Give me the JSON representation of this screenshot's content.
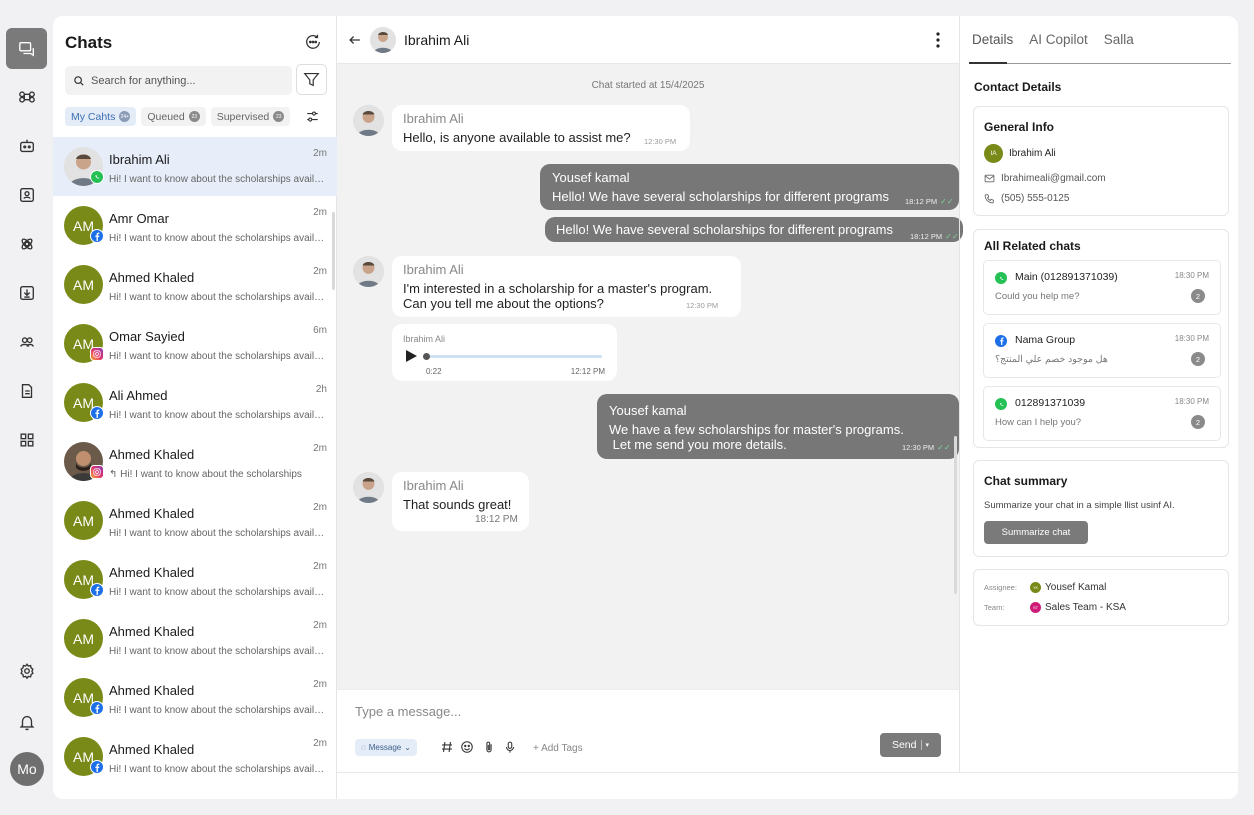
{
  "colors": {
    "accent_blue": "#3d6fb4",
    "avatar_olive": "#7a8a18",
    "whatsapp": "#25c155",
    "facebook": "#1c6fe8",
    "neutral_button": "#7a7a7a"
  },
  "rail": {
    "icons": [
      "chat-bubbles-icon",
      "command-icon",
      "bot-icon",
      "contacts-icon",
      "integrations-icon",
      "download-icon",
      "team-icon",
      "document-icon",
      "apps-grid-icon",
      "settings-icon",
      "bell-icon"
    ],
    "user_initials": "Mo"
  },
  "list": {
    "title": "Chats",
    "search_placeholder": "Search for anything...",
    "tabs": [
      {
        "label": "My Cahts",
        "count": "24+"
      },
      {
        "label": "Queued",
        "count": "23"
      },
      {
        "label": "Supervised",
        "count": "23"
      }
    ],
    "items": [
      {
        "name": "Ibrahim Ali",
        "initials": "",
        "time": "2m",
        "preview": "Hi! I want to know about the scholarships available",
        "channel": "whatsapp"
      },
      {
        "name": "Amr Omar",
        "initials": "AM",
        "time": "2m",
        "preview": "Hi! I want to know about the scholarships available",
        "channel": "facebook"
      },
      {
        "name": "Ahmed Khaled",
        "initials": "AM",
        "time": "2m",
        "preview": "Hi! I want to know about the scholarships available",
        "channel": ""
      },
      {
        "name": "Omar Sayied",
        "initials": "AM",
        "time": "6m",
        "preview": "Hi! I want to know about the scholarships available",
        "channel": "instagram"
      },
      {
        "name": "Ali Ahmed",
        "initials": "AM",
        "time": "2h",
        "preview": "Hi! I want to know about the scholarships available",
        "channel": "facebook"
      },
      {
        "name": "Ahmed Khaled",
        "initials": "",
        "time": "2m",
        "preview": "↰ Hi! I want to know about the scholarships",
        "channel": "instagram"
      },
      {
        "name": "Ahmed Khaled",
        "initials": "AM",
        "time": "2m",
        "preview": "Hi! I want to know about the scholarships available",
        "channel": ""
      },
      {
        "name": "Ahmed Khaled",
        "initials": "AM",
        "time": "2m",
        "preview": "Hi! I want to know about the scholarships available",
        "channel": "facebook"
      },
      {
        "name": "Ahmed Khaled",
        "initials": "AM",
        "time": "2m",
        "preview": "Hi! I want to know about the scholarships available",
        "channel": ""
      },
      {
        "name": "Ahmed Khaled",
        "initials": "AM",
        "time": "2m",
        "preview": "Hi! I want to know about the scholarships available",
        "channel": "facebook"
      },
      {
        "name": "Ahmed Khaled",
        "initials": "AM",
        "time": "2m",
        "preview": "Hi! I want to know about the scholarships available",
        "channel": "facebook"
      }
    ]
  },
  "conversation": {
    "contact_name": "Ibrahim Ali",
    "started": "Chat started at 15/4/2025",
    "messages": [
      {
        "sender": "Ibrahim Ali",
        "text": "Hello, is anyone available to assist me?",
        "time": "12:30 PM"
      },
      {
        "sender": "Yousef kamal",
        "text": "Hello! We have several scholarships for different programs",
        "time": "18:12 PM"
      },
      {
        "sender": "",
        "text": "Hello! We have several scholarships for different programs",
        "time": "18:12 PM"
      },
      {
        "sender": "Ibrahim Ali",
        "text_line1": "I'm interested in a scholarship for a master's program.",
        "text_line2": "Can you tell me about the options?",
        "time": "12:30 PM"
      },
      {
        "sender": "Yousef kamal",
        "text_line1": "We have a few scholarships for master's programs.",
        "text_line2": " Let me send you more details.",
        "time": "12:30 PM"
      },
      {
        "sender": "Ibrahim Ali",
        "text": "That sounds great!",
        "time": "18:12 PM"
      }
    ],
    "voice": {
      "sender": "Ibrahim Ali",
      "elapsed": "0:22",
      "time": "12:12 PM",
      "progress": 0
    }
  },
  "composer": {
    "placeholder": "Type a message...",
    "type_label": "Message",
    "add_tags": "+ Add Tags",
    "send_label": "Send"
  },
  "details": {
    "tabs": [
      "Details",
      "AI Copilot",
      "Salla"
    ],
    "section_title": "Contact Details",
    "general_info": {
      "title": "General Info",
      "initials": "IA",
      "name": "Ibrahim Ali",
      "email": "Ibrahimeali@gmail.com",
      "phone": "(505) 555-0125"
    },
    "related": {
      "title": "All Related chats",
      "items": [
        {
          "name": "Main (012891371039)",
          "time": "18:30 PM",
          "message": "Could you help me?",
          "count": "2",
          "channel": "whatsapp"
        },
        {
          "name": "Nama Group",
          "time": "18:30 PM",
          "message": "هل موجود خصم علي المنتج؟",
          "count": "2",
          "channel": "facebook"
        },
        {
          "name": "012891371039",
          "time": "18:30 PM",
          "message": "How can I help you?",
          "count": "2",
          "channel": "whatsapp"
        }
      ]
    },
    "summary": {
      "title": "Chat summary",
      "text": "Summarize your chat in a simple llist usinf AI.",
      "button": "Summarize chat"
    },
    "assignment": {
      "assignee_label": "Assignee:",
      "assignee": "Yousef Kamal",
      "assignee_initials": "YK",
      "team_label": "Team:",
      "team": "Sales Team - KSA",
      "team_initials": "ST"
    }
  }
}
